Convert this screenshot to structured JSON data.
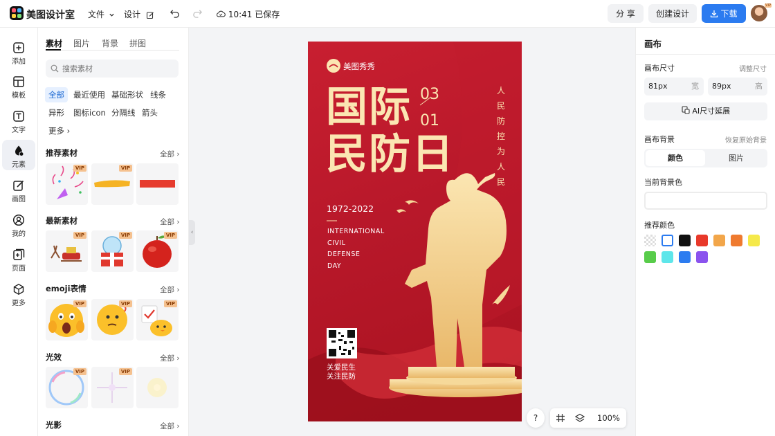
{
  "app": {
    "name": "美图设计室"
  },
  "topbar": {
    "file_menu": "文件",
    "design_menu": "设计",
    "save_status": "10:41 已保存",
    "share_label": "分 享",
    "create_label": "创建设计",
    "download_label": "下载",
    "avatar_badge": "VIP"
  },
  "left_nav": [
    {
      "label": "添加"
    },
    {
      "label": "模板"
    },
    {
      "label": "文字"
    },
    {
      "label": "元素"
    },
    {
      "label": "画图"
    },
    {
      "label": "我的"
    },
    {
      "label": "页面"
    },
    {
      "label": "更多"
    }
  ],
  "panel": {
    "tabs": [
      "素材",
      "图片",
      "背景",
      "拼图"
    ],
    "search_placeholder": "搜索素材",
    "chips": [
      "全部",
      "最近使用",
      "基础形状",
      "线条",
      "异形",
      "图标icon",
      "分隔线",
      "箭头",
      "更多"
    ],
    "see_all": "全部",
    "vip": "VIP",
    "sections": [
      "推荐素材",
      "最新素材",
      "emoji表情",
      "光效",
      "光影"
    ]
  },
  "poster": {
    "brand": "美图秀秀",
    "title_line1": "国际",
    "title_line2": "民防日",
    "date_month": "03",
    "date_day": "01",
    "vertical_text": [
      "人",
      "民",
      "防",
      "控",
      "为",
      "人",
      "民"
    ],
    "years": "1972-2022",
    "english": [
      "INTERNATIONAL",
      "CIVIL",
      "DEFENSE",
      "DAY"
    ],
    "slogan1": "关爱民生",
    "slogan2": "关注民防"
  },
  "right_panel": {
    "title": "画布",
    "size_label": "画布尺寸",
    "adjust_size": "调整尺寸",
    "width_value": "81px",
    "width_unit": "宽",
    "height_value": "89px",
    "height_unit": "高",
    "ai_extend": "AI尺寸延展",
    "bg_label": "画布背景",
    "restore_bg": "恢复原始背景",
    "bg_color_tab": "颜色",
    "bg_image_tab": "图片",
    "current_bg_label": "当前背景色",
    "recommended_label": "推荐颜色",
    "swatches": [
      "transparent",
      "#ffffff",
      "#111111",
      "#e8392a",
      "#f2a64a",
      "#ef7a2f",
      "#f5e94a",
      "#58cc4a",
      "#5ee6ea",
      "#2c7cf0",
      "#8b53ee"
    ]
  },
  "bottom": {
    "help": "?",
    "zoom": "100%"
  }
}
